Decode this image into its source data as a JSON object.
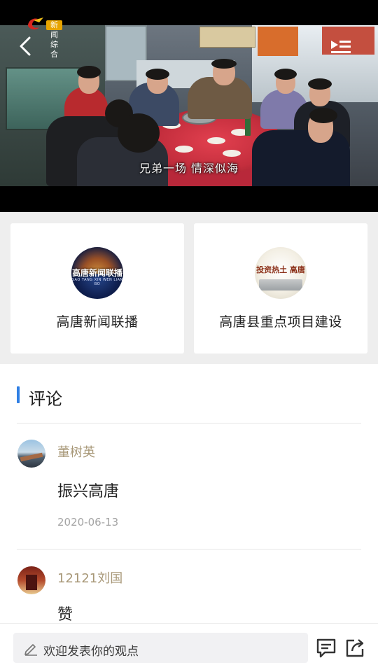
{
  "video": {
    "channel_label": "新闻综合",
    "subtitle": "兄弟一场 情深似海"
  },
  "related": [
    {
      "title": "高唐新闻联播",
      "thumb_text": "高唐新闻联播",
      "thumb_sub": "GAO TANG XIN WEN LIAN BO"
    },
    {
      "title": "高唐县重点项目建设",
      "thumb_text": "投资热土 高唐"
    }
  ],
  "comments_section": {
    "title": "评论",
    "items": [
      {
        "user": "董树英",
        "text": "振兴高唐",
        "date": "2020-06-13"
      },
      {
        "user": "12121刘国",
        "text": "赞"
      }
    ]
  },
  "bottom_bar": {
    "input_placeholder": "欢迎发表你的观点"
  },
  "icons": {
    "back": "chevron-left-icon",
    "playlist": "playlist-icon",
    "pen": "pen-icon",
    "comment": "comment-icon",
    "share": "share-icon"
  },
  "colors": {
    "accent": "#2f7fe4",
    "username": "#a89878",
    "channel_badge": "#e7a400"
  }
}
